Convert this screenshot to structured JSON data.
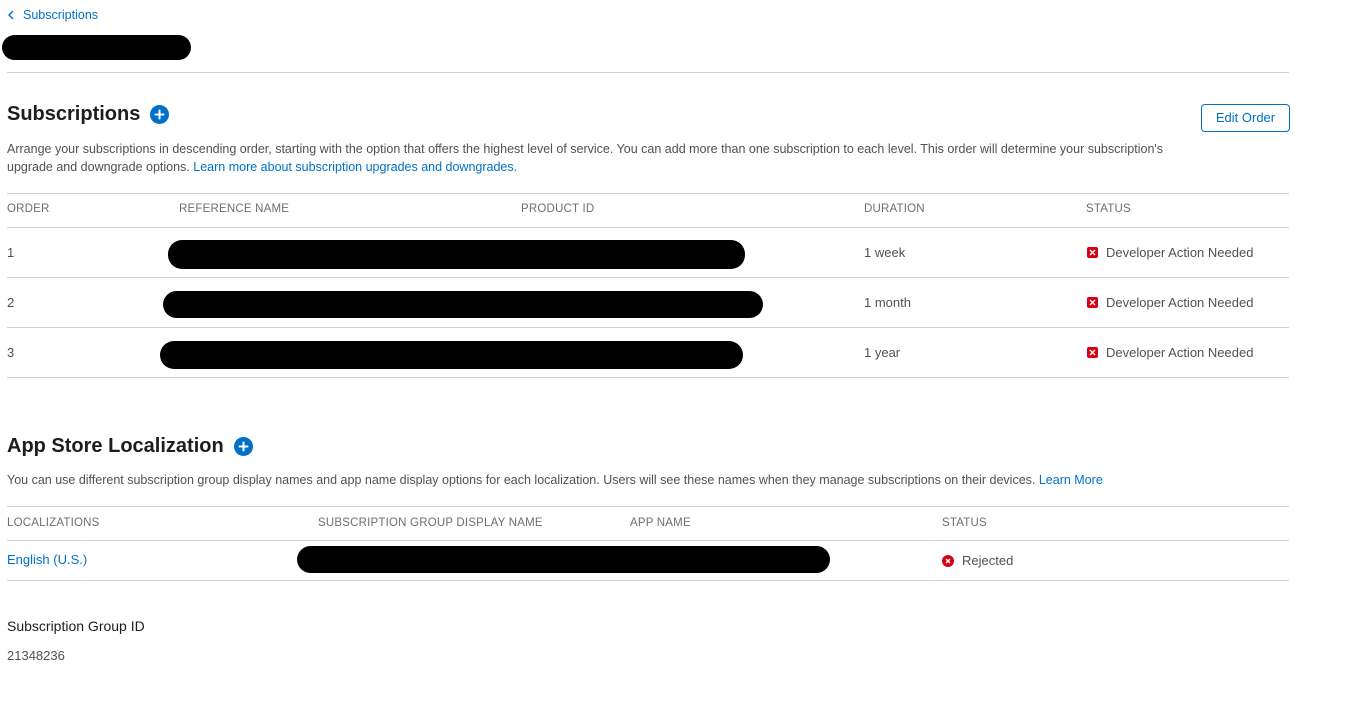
{
  "nav": {
    "back_label": "Subscriptions"
  },
  "subscriptions": {
    "title": "Subscriptions",
    "edit_order_label": "Edit Order",
    "description": "Arrange your subscriptions in descending order, starting with the option that offers the highest level of service. You can add more than one subscription to each level. This order will determine your subscription's upgrade and downgrade options.",
    "learn_more_label": "Learn more about subscription upgrades and downgrades.",
    "columns": [
      "ORDER",
      "REFERENCE NAME",
      "PRODUCT ID",
      "DURATION",
      "STATUS"
    ],
    "rows": [
      {
        "order": "1",
        "duration": "1 week",
        "status": "Developer Action Needed"
      },
      {
        "order": "2",
        "duration": "1 month",
        "status": "Developer Action Needed"
      },
      {
        "order": "3",
        "duration": "1 year",
        "status": "Developer Action Needed"
      }
    ]
  },
  "localization": {
    "title": "App Store Localization",
    "description": "You can use different subscription group display names and app name display options for each localization. Users will see these names when they manage subscriptions on their devices.",
    "learn_more_label": "Learn More",
    "columns": [
      "LOCALIZATIONS",
      "SUBSCRIPTION GROUP DISPLAY NAME",
      "APP NAME",
      "STATUS"
    ],
    "rows": [
      {
        "localization": "English (U.S.)",
        "status": "Rejected"
      }
    ]
  },
  "group": {
    "label": "Subscription Group ID",
    "value": "21348236"
  },
  "colors": {
    "accent": "#0070c9",
    "error": "#d70015",
    "rule": "#d2d2d7"
  },
  "icons": {
    "back": "chevron-left-icon",
    "add": "plus-circle-icon",
    "status_error": "x-square-icon",
    "status_rejected": "x-circle-icon"
  }
}
